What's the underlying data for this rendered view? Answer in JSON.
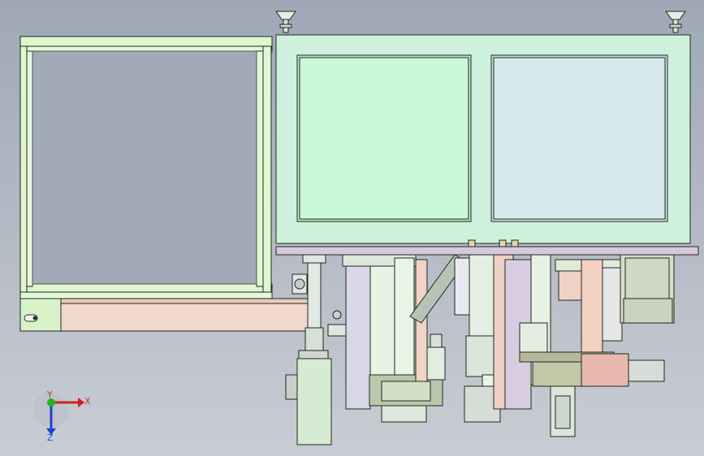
{
  "viewport": {
    "background_top": "#9ea8b6",
    "background_bottom": "#c9ccd3",
    "model_colors": {
      "frame": "#d9f5cf",
      "frame_edge": "#2a3a2a",
      "hood": "#cdf1dc",
      "window_left": "#cbf8d6",
      "window_right": "#d5e8ec",
      "plate": "#d8c8dc",
      "rail": "#f0d6c8",
      "cylinder": "#d3d9d3",
      "motor": "#e8b8b0",
      "bracket": "#b8b89c"
    }
  },
  "triad": {
    "x_label": "X",
    "y_label": "Y",
    "z_label": "Z",
    "x_color": "#d21f1f",
    "y_color": "#1fb51f",
    "z_color": "#1f3fd2"
  },
  "icons": {
    "leveling_foot_left": "leveling-foot-icon",
    "leveling_foot_right": "leveling-foot-icon",
    "coordinate_triad": "axis-triad-icon"
  }
}
